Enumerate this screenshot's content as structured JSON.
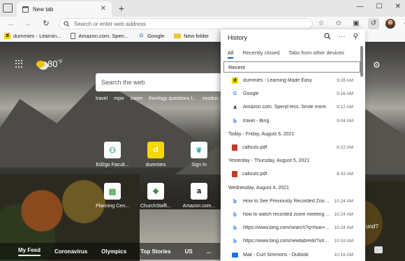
{
  "tab": {
    "title": "New tab"
  },
  "address_bar": {
    "placeholder": "Search or enter web address"
  },
  "favorites": [
    {
      "label": "dummies - Learnin...",
      "icon": "dummies-icon"
    },
    {
      "label": "Amazon.com. Spen...",
      "icon": "page-icon"
    },
    {
      "label": "Google",
      "icon": "google-icon"
    },
    {
      "label": "New folder",
      "icon": "folder-icon"
    }
  ],
  "ntp": {
    "temperature": "80",
    "temp_unit": "°F",
    "search_placeholder": "Search the web",
    "trending": [
      "travel",
      "mpix",
      "zoom",
      "theology questions f...",
      "exodus 33"
    ],
    "tiles": [
      {
        "label": "Ed2go Facult...",
        "icon": "ed2go-icon"
      },
      {
        "label": "dummies",
        "icon": "dummies-icon"
      },
      {
        "label": "Sign In",
        "icon": "signin-icon"
      },
      {
        "label": "Planning Cen...",
        "icon": "planning-center-icon"
      },
      {
        "label": "ChurchStaffi...",
        "icon": "churchstaffing-icon"
      },
      {
        "label": "Amazon.com...",
        "icon": "amazon-icon"
      }
    ],
    "feed_tabs": [
      "My Feed",
      "Coronavirus",
      "Olympics",
      "Top Stories",
      "US",
      "..."
    ],
    "scroll_hint": "und?"
  },
  "history": {
    "title": "History",
    "tabs": [
      "All",
      "Recently closed",
      "Tabs from other devices"
    ],
    "section": "Recent",
    "recent": [
      {
        "title": "dummies - Learning Made Easy",
        "time": "9:28 AM",
        "icon": "dummies-icon"
      },
      {
        "title": "Google",
        "time": "9:16 AM",
        "icon": "google-icon"
      },
      {
        "title": "Amazon.com. Spend less. Smile more.",
        "time": "9:12 AM",
        "icon": "amazon-icon"
      },
      {
        "title": "travel - Bing",
        "time": "9:04 AM",
        "icon": "bing-icon"
      }
    ],
    "day1": {
      "label": "Today - Friday, August 6, 2021",
      "items": [
        {
          "title": "callouts.pdf",
          "time": "8:22 AM",
          "icon": "pdf-icon"
        }
      ]
    },
    "day2": {
      "label": "Yesterday - Thursday, August 5, 2021",
      "items": [
        {
          "title": "callouts.pdf",
          "time": "8:33 AM",
          "icon": "pdf-icon"
        }
      ]
    },
    "day3": {
      "label": "Wednesday, August 4, 2021",
      "items": [
        {
          "title": "How to See Previously Recorded Zoom M...",
          "time": "10:24 AM",
          "icon": "bing-icon"
        },
        {
          "title": "how to watch recorded zoom meeting - Bi...",
          "time": "10:24 AM",
          "icon": "bing-icon"
        },
        {
          "title": "https://www.bing.com/search?q=how+to+...",
          "time": "10:24 AM",
          "icon": "bing-icon"
        },
        {
          "title": "https://www.bing.com/newtabredir?url=...",
          "time": "10:19 AM",
          "icon": "bing-icon"
        },
        {
          "title": "Mail - Curt Simmons - Outlook",
          "time": "10:19 AM",
          "icon": "mail-icon"
        }
      ]
    }
  }
}
